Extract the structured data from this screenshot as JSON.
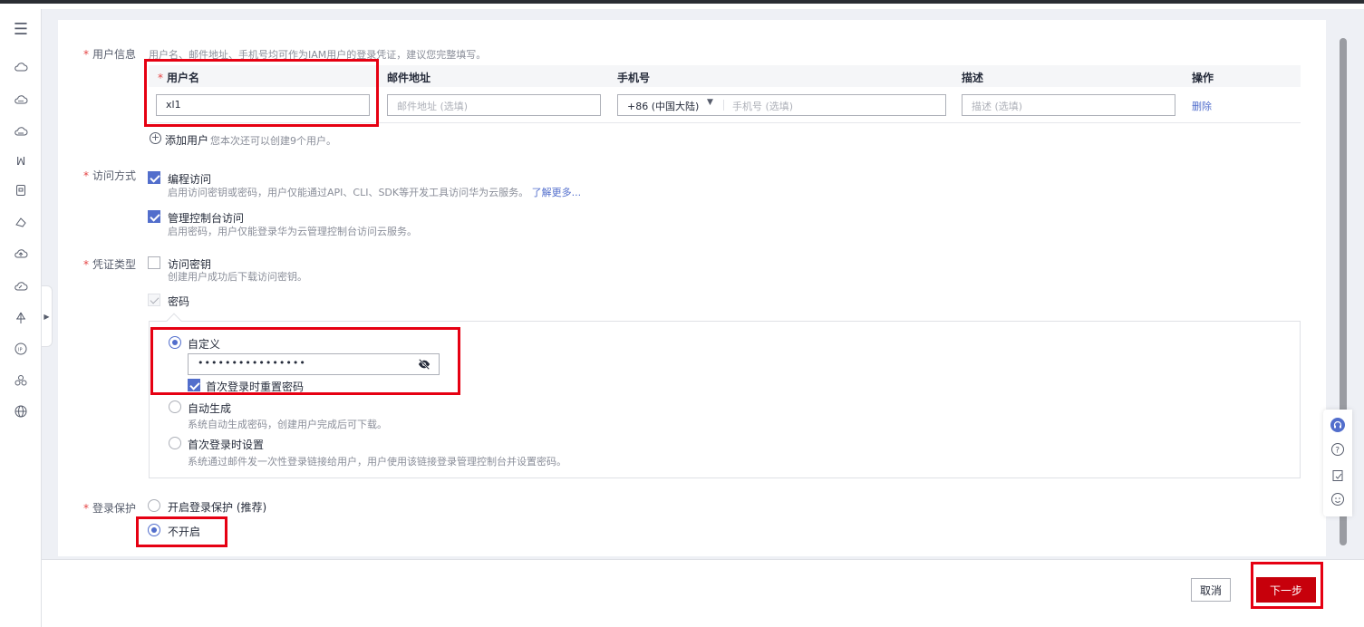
{
  "nav_icons": [
    "cloud-icon",
    "cloud-dots-icon",
    "cloud-stack-icon",
    "bars-icon",
    "device-icon",
    "shape-icon",
    "cloud-up-icon",
    "cloud-edit-icon",
    "branch-icon",
    "ip-icon",
    "group-icon",
    "globe-icon"
  ],
  "user_info": {
    "label": "用户信息",
    "hint": "用户名、邮件地址、手机号均可作为IAM用户的登录凭证，建议您完整填写。",
    "columns": {
      "username": "用户名",
      "email": "邮件地址",
      "phone": "手机号",
      "desc": "描述",
      "action": "操作"
    },
    "row": {
      "username": "xl1",
      "email_placeholder": "邮件地址 (选填)",
      "phone_country": "+86 (中国大陆)",
      "phone_placeholder": "手机号 (选填)",
      "desc_placeholder": "描述 (选填)",
      "delete": "删除"
    },
    "add_user": "添加用户",
    "add_hint": "您本次还可以创建9个用户。"
  },
  "access": {
    "label": "访问方式",
    "programmatic": {
      "title": "编程访问",
      "desc": "启用访问密钥或密码，用户仅能通过API、CLI、SDK等开发工具访问华为云服务。",
      "more": "了解更多...",
      "checked": true
    },
    "console": {
      "title": "管理控制台访问",
      "desc": "启用密码，用户仅能登录华为云管理控制台访问云服务。",
      "checked": true
    }
  },
  "credential": {
    "label": "凭证类型",
    "access_key": {
      "title": "访问密钥",
      "desc": "创建用户成功后下载访问密钥。",
      "checked": false
    },
    "password": {
      "title": "密码",
      "checked": true
    },
    "custom": {
      "title": "自定义",
      "value": "••••••••••••••••",
      "reset_label": "首次登录时重置密码",
      "reset_checked": true
    },
    "auto": {
      "title": "自动生成",
      "desc": "系统自动生成密码，创建用户完成后可下载。"
    },
    "first_login": {
      "title": "首次登录时设置",
      "desc": "系统通过邮件发一次性登录链接给用户，用户使用该链接登录管理控制台并设置密码。"
    }
  },
  "login_protect": {
    "label": "登录保护",
    "enable": "开启登录保护 (推荐)",
    "disable": "不开启"
  },
  "footer": {
    "cancel": "取消",
    "next": "下一步"
  },
  "float_tools": [
    "headset-icon",
    "help-icon",
    "feedback-icon",
    "smile-icon"
  ],
  "colors": {
    "accent": "#526ecc",
    "primary": "#c7000b",
    "highlight": "#e60012",
    "required": "#e54545"
  }
}
